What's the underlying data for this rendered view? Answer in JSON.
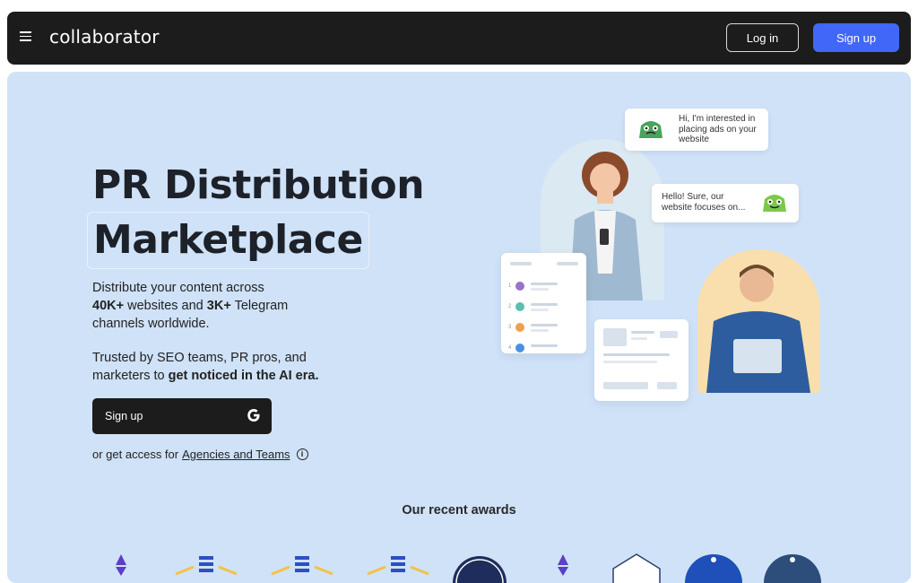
{
  "header": {
    "logo_text": "collaborator",
    "login_label": "Log in",
    "signup_label": "Sign up"
  },
  "hero": {
    "title_line1": "PR Distribution",
    "title_line2": "Marketplace",
    "desc_prefix": "Distribute your content across",
    "desc_websites_count": "40K+",
    "desc_websites_suffix": "websites and",
    "desc_telegram_count": "3K+",
    "desc_telegram_suffix": "Telegram",
    "desc_suffix": "channels worldwide.",
    "trust_prefix": "Trusted by SEO teams, PR pros, and marketers to",
    "trust_bold": "get noticed in the AI era.",
    "signup_label": "Sign up",
    "access_prefix": "or get access for",
    "access_link": "Agencies and Teams"
  },
  "illustration": {
    "bubble1": "Hi, I'm interested in placing ads on your website",
    "bubble2": "Hello! Sure, our website focuses on...",
    "list_numbers": [
      "1",
      "2",
      "3",
      "4"
    ]
  },
  "awards": {
    "title": "Our recent awards"
  },
  "colors": {
    "accent": "#4167f8",
    "header_bg": "#1c1c1c",
    "hero_bg": "#cfe2f7"
  }
}
